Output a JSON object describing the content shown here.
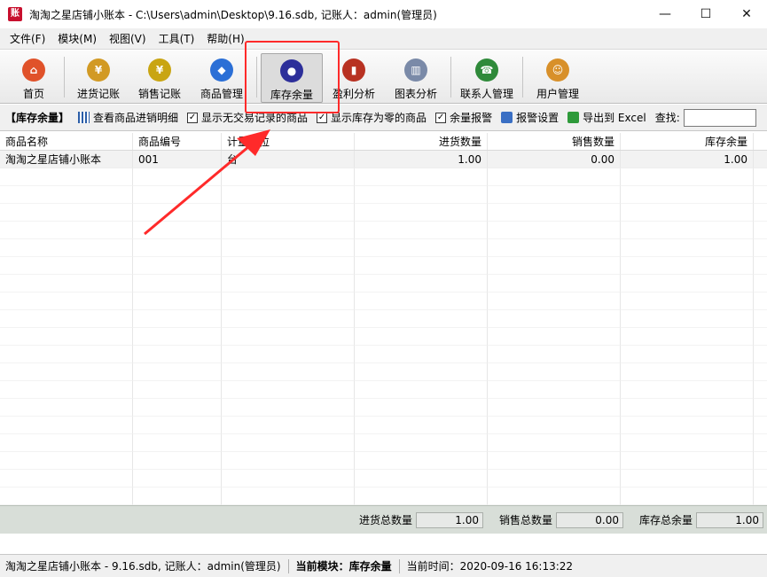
{
  "window": {
    "app_icon": "账",
    "title": "淘淘之星店铺小账本 - C:\\Users\\admin\\Desktop\\9.16.sdb,  记账人：admin(管理员)",
    "minimize": "—",
    "maximize": "☐",
    "close": "✕"
  },
  "menu": [
    "文件(F)",
    "模块(M)",
    "视图(V)",
    "工具(T)",
    "帮助(H)"
  ],
  "toolbar": [
    {
      "label": "首页",
      "icon": "home-icon",
      "color": "#e0522a",
      "glyph": "⌂"
    },
    {
      "label": "进货记账",
      "icon": "purchase-icon",
      "color": "#d29a24",
      "glyph": "¥"
    },
    {
      "label": "销售记账",
      "icon": "sales-icon",
      "color": "#c9a512",
      "glyph": "¥"
    },
    {
      "label": "商品管理",
      "icon": "product-icon",
      "color": "#2b6fd6",
      "glyph": "◆"
    },
    {
      "label": "库存余量",
      "icon": "inventory-icon",
      "color": "#2d2f9a",
      "glyph": "●"
    },
    {
      "label": "盈利分析",
      "icon": "profit-icon",
      "color": "#b83222",
      "glyph": "▮"
    },
    {
      "label": "图表分析",
      "icon": "chart-icon",
      "color": "#7a8aa8",
      "glyph": "▥"
    },
    {
      "label": "联系人管理",
      "icon": "contacts-icon",
      "color": "#2f8a3a",
      "glyph": "☎"
    },
    {
      "label": "用户管理",
      "icon": "users-icon",
      "color": "#d8902a",
      "glyph": "☺"
    }
  ],
  "subbar": {
    "title": "【库存余量】",
    "view_detail": "查看商品进销明细",
    "show_no_trade": "显示无交易记录的商品",
    "show_zero_stock": "显示库存为零的商品",
    "stock_alarm": "余量报警",
    "alarm_settings": "报警设置",
    "export_excel": "导出到 Excel",
    "search_label": "查找:",
    "search_value": ""
  },
  "grid": {
    "columns": [
      "商品名称",
      "商品编号",
      "计量单位",
      "进货数量",
      "销售数量",
      "库存余量"
    ],
    "rows": [
      [
        "淘淘之星店铺小账本",
        "001",
        "台",
        "1.00",
        "0.00",
        "1.00"
      ]
    ]
  },
  "totals": {
    "purchase_label": "进货总数量",
    "purchase_value": "1.00",
    "sales_label": "销售总数量",
    "sales_value": "0.00",
    "stock_label": "库存总余量",
    "stock_value": "1.00"
  },
  "status": {
    "file": "淘淘之星店铺小账本 - 9.16.sdb,  记账人：admin(管理员)",
    "module": "当前模块：库存余量",
    "time": "当前时间：2020-09-16 16:13:22"
  },
  "colors": {
    "highlight": "#ff2a2a"
  }
}
